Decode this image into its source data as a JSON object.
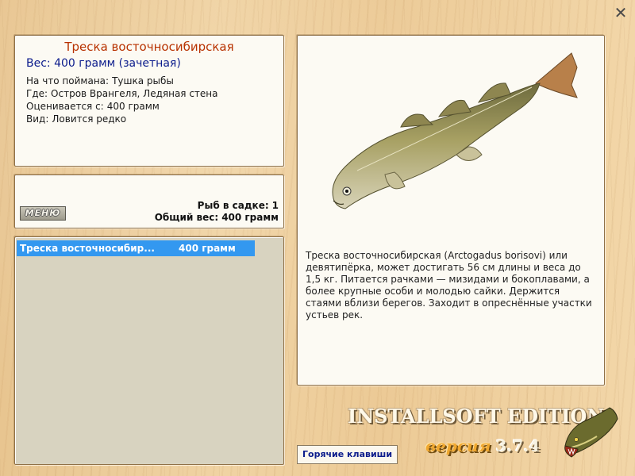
{
  "info": {
    "title": "Треска восточносибирская",
    "weight": "Вес: 400 грамм (зачетная)",
    "lines": [
      {
        "label": "На что поймана:",
        "value": "Тушка рыбы"
      },
      {
        "label": "Где:",
        "value": "Остров Врангеля, Ледяная стена"
      },
      {
        "label": "Оценивается с:",
        "value": "400 грамм"
      },
      {
        "label": "Вид:",
        "value": "Ловится редко"
      }
    ]
  },
  "stats": {
    "menu_label": "МЕНЮ",
    "cage_label": "Рыб в садке:",
    "cage_value": "1",
    "total_label": "Общий вес:",
    "total_value": "400 грамм"
  },
  "list": {
    "rows": [
      {
        "name": "Треска восточносибир...",
        "weight": "400 грамм"
      }
    ]
  },
  "description": "Треска восточносибирская (Arctogadus borisovi) или девятипёрка, может достигать 56 см длины и веса до 1,5 кг. Питается рачками — мизидами и бокоплавами, а более крупные особи и молодью сайки. Держится стаями вблизи берегов. Заходит в опреснённые участки устьев рек.",
  "footer": {
    "hotkeys": "Горячие клавиши",
    "brand": "INSTALLSOFT EDITION",
    "version_label": "версия",
    "version_number": "3.7.4"
  },
  "close_icon": "close-icon",
  "colors": {
    "title": "#b83200",
    "weight": "#0c1c8c",
    "selection": "#3398f0"
  }
}
